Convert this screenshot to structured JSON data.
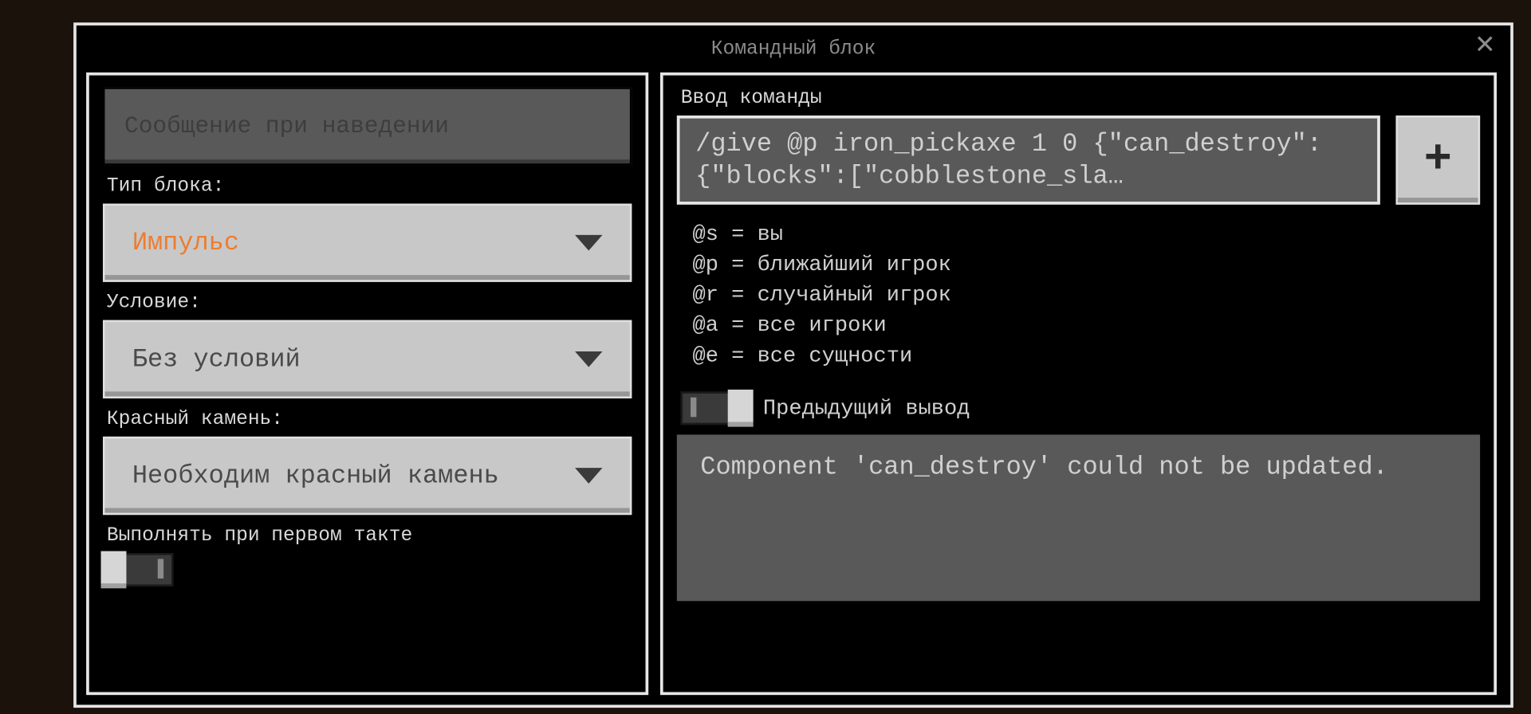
{
  "title": "Командный блок",
  "left": {
    "hover_placeholder": "Сообщение при наведении",
    "block_type_label": "Тип блока:",
    "block_type_value": "Импульс",
    "condition_label": "Условие:",
    "condition_value": "Без условий",
    "redstone_label": "Красный камень:",
    "redstone_value": "Необходим красный камень",
    "first_tick_label": "Выполнять при первом такте"
  },
  "right": {
    "input_label": "Ввод команды",
    "command_text": "/give @p iron_pickaxe 1 0 {\"can_destroy\":{\"blocks\":[\"cobblestone_sla…",
    "hints": [
      "@s = вы",
      "@p = ближайший игрок",
      "@r = случайный игрок",
      "@a = все игроки",
      "@e = все сущности"
    ],
    "prev_output_toggle_label": "Предыдущий вывод",
    "output_text": "Component 'can_destroy' could not be updated."
  }
}
